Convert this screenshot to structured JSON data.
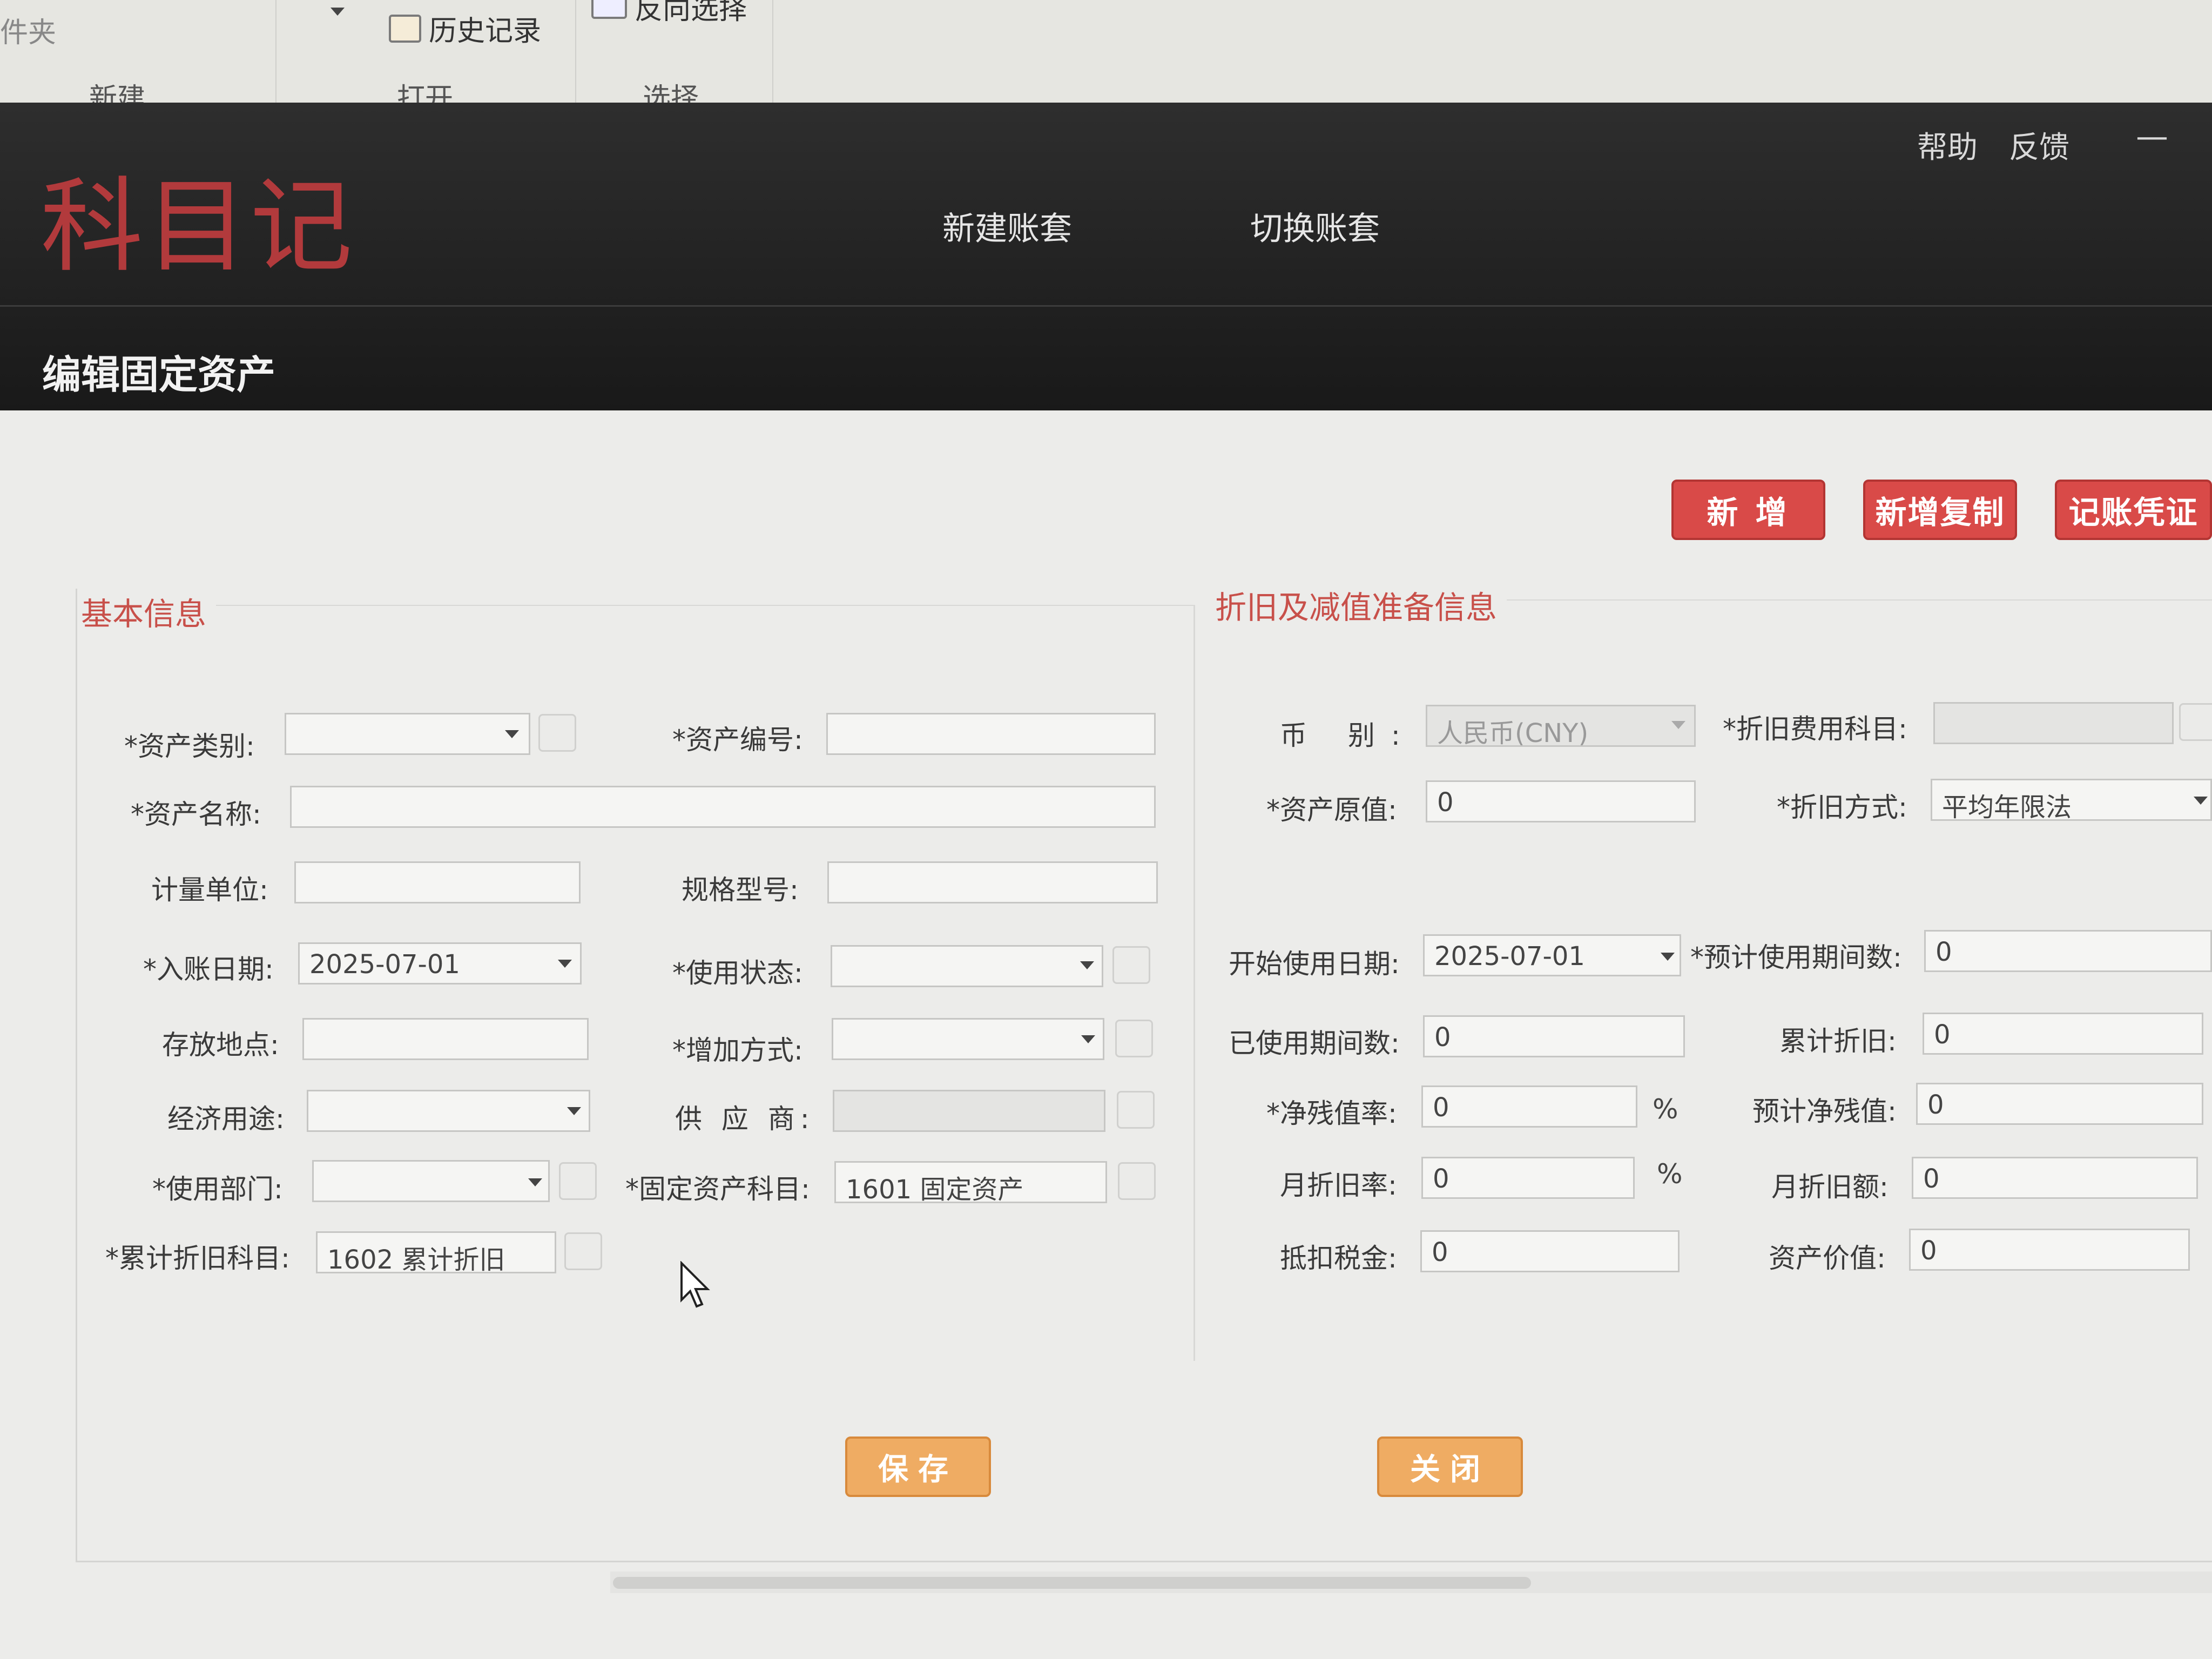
{
  "ribbon": {
    "folder_label": "件夹",
    "history_label": "历史记录",
    "reverse_select_label": "反向选择",
    "group_new": "新建",
    "group_open": "打开",
    "group_select": "选择"
  },
  "app": {
    "logo": "科目记",
    "help_label": "帮助",
    "feedback_label": "反馈",
    "minimize_label": "—",
    "nav": [
      "新建账套",
      "切换账套"
    ],
    "page_title": "编辑固定资产"
  },
  "actions": {
    "add": "新 增",
    "add_copy": "新增复制",
    "voucher": "记账凭证"
  },
  "basic": {
    "section_title": "基本信息",
    "asset_category_label": "*资产类别:",
    "asset_category_value": "",
    "asset_code_label": "*资产编号:",
    "asset_code_value": "",
    "asset_name_label": "*资产名称:",
    "asset_name_value": "",
    "unit_label": "计量单位:",
    "unit_value": "",
    "spec_label": "规格型号:",
    "spec_value": "",
    "entry_date_label": "*入账日期:",
    "entry_date_value": "2025-07-01",
    "usage_status_label": "*使用状态:",
    "usage_status_value": "",
    "location_label": "存放地点:",
    "location_value": "",
    "add_method_label": "*增加方式:",
    "add_method_value": "",
    "economic_use_label": "经济用途:",
    "economic_use_value": "",
    "supplier_label": "供 应 商:",
    "supplier_value": "",
    "department_label": "*使用部门:",
    "department_value": "",
    "fa_account_label": "*固定资产科目:",
    "fa_account_value": "1601 固定资产",
    "acc_dep_account_label": "*累计折旧科目:",
    "acc_dep_account_value": "1602 累计折旧"
  },
  "dep": {
    "section_title": "折旧及减值准备信息",
    "currency_label": "币 别:",
    "currency_value": "人民币(CNY)",
    "dep_expense_label": "*折旧费用科目:",
    "dep_expense_value": "",
    "original_value_label": "*资产原值:",
    "original_value": "0",
    "dep_method_label": "*折旧方式:",
    "dep_method_value": "平均年限法",
    "start_date_label": "开始使用日期:",
    "start_date_value": "2025-07-01",
    "expected_periods_label": "*预计使用期间数:",
    "expected_periods_value": "0",
    "used_periods_label": "已使用期间数:",
    "used_periods_value": "0",
    "acc_dep_label": "累计折旧:",
    "acc_dep_value": "0",
    "residual_rate_label": "*净残值率:",
    "residual_rate_value": "0",
    "residual_rate_unit": "%",
    "expected_residual_label": "预计净残值:",
    "expected_residual_value": "0",
    "monthly_rate_label": "月折旧率:",
    "monthly_rate_value": "0",
    "monthly_rate_unit": "%",
    "monthly_amount_label": "月折旧额:",
    "monthly_amount_value": "0",
    "tax_label": "抵扣税金:",
    "tax_value": "0",
    "asset_value_label": "资产价值:",
    "asset_value": "0"
  },
  "footer": {
    "save": "保存",
    "close": "关闭"
  }
}
